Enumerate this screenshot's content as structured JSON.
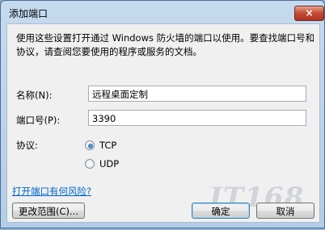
{
  "window": {
    "title": "添加端口",
    "close_glyph": "×"
  },
  "intro_text": "使用这些设置打开通过 Windows 防火墙的端口以使用。要查找端口号和协议，请查阅您要使用的程序或服务的文档。",
  "fields": {
    "name_label": "名称(N):",
    "name_value": "远程桌面定制",
    "port_label": "端口号(P):",
    "port_value": "3390",
    "protocol_label": "协议:"
  },
  "protocol_options": [
    {
      "label": "TCP",
      "selected": true
    },
    {
      "label": "UDP",
      "selected": false
    }
  ],
  "risk_link": "打开端口有何风险?",
  "buttons": {
    "change_scope": "更改范围(C)...",
    "ok": "确定",
    "cancel": "取消"
  },
  "watermark_text": "IT168",
  "colors": {
    "link": "#0066cc",
    "close_button": "#c44a33"
  }
}
